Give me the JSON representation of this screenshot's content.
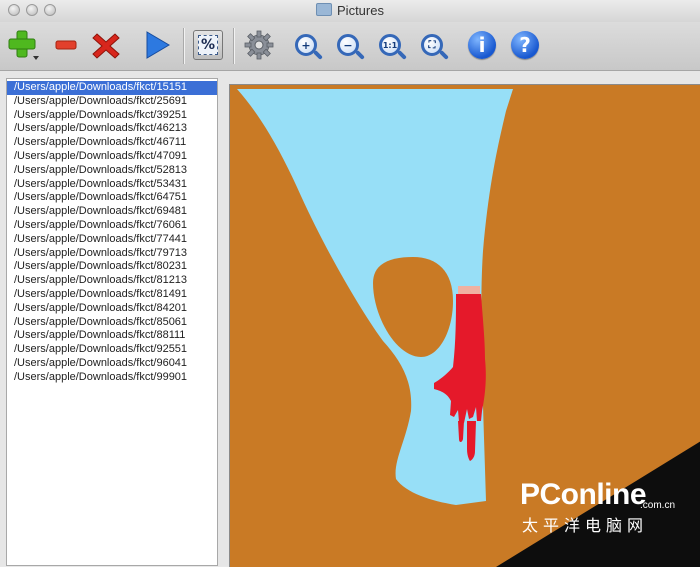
{
  "window": {
    "title": "Pictures"
  },
  "toolbar": {
    "buttons": [
      {
        "name": "add",
        "icon": "plus-icon"
      },
      {
        "name": "remove",
        "icon": "minus-icon"
      },
      {
        "name": "delete",
        "icon": "x-icon"
      },
      {
        "name": "play",
        "icon": "play-icon"
      },
      {
        "name": "fit-percent",
        "icon": "percent-icon",
        "glyph": "%"
      },
      {
        "name": "settings",
        "icon": "gear-icon"
      },
      {
        "name": "zoom-in",
        "icon": "zoom-in-icon",
        "glyph": "+"
      },
      {
        "name": "zoom-out",
        "icon": "zoom-out-icon",
        "glyph": "−"
      },
      {
        "name": "zoom-actual",
        "icon": "zoom-actual-icon",
        "glyph": "1:1"
      },
      {
        "name": "zoom-fit",
        "icon": "zoom-fit-icon",
        "glyph": "⛶"
      },
      {
        "name": "info",
        "icon": "info-icon",
        "glyph": "i"
      },
      {
        "name": "help",
        "icon": "help-icon",
        "glyph": "?"
      }
    ]
  },
  "file_list": {
    "selected_index": 0,
    "items": [
      "/Users/apple/Downloads/fkct/15151",
      "/Users/apple/Downloads/fkct/25691",
      "/Users/apple/Downloads/fkct/39251",
      "/Users/apple/Downloads/fkct/46213",
      "/Users/apple/Downloads/fkct/46711",
      "/Users/apple/Downloads/fkct/47091",
      "/Users/apple/Downloads/fkct/52813",
      "/Users/apple/Downloads/fkct/53431",
      "/Users/apple/Downloads/fkct/64751",
      "/Users/apple/Downloads/fkct/69481",
      "/Users/apple/Downloads/fkct/76061",
      "/Users/apple/Downloads/fkct/77441",
      "/Users/apple/Downloads/fkct/79713",
      "/Users/apple/Downloads/fkct/80231",
      "/Users/apple/Downloads/fkct/81213",
      "/Users/apple/Downloads/fkct/81491",
      "/Users/apple/Downloads/fkct/84201",
      "/Users/apple/Downloads/fkct/85061",
      "/Users/apple/Downloads/fkct/88111",
      "/Users/apple/Downloads/fkct/92551",
      "/Users/apple/Downloads/fkct/96041",
      "/Users/apple/Downloads/fkct/99901"
    ]
  },
  "watermark": {
    "brand": "PConline",
    "domain": ".com.cn",
    "cn_text": "太平洋电脑网"
  },
  "colors": {
    "image_brown": "#c97a25",
    "image_sky": "#97dff7",
    "hand_red": "#e5192a",
    "selection_blue": "#3b6fd6"
  }
}
